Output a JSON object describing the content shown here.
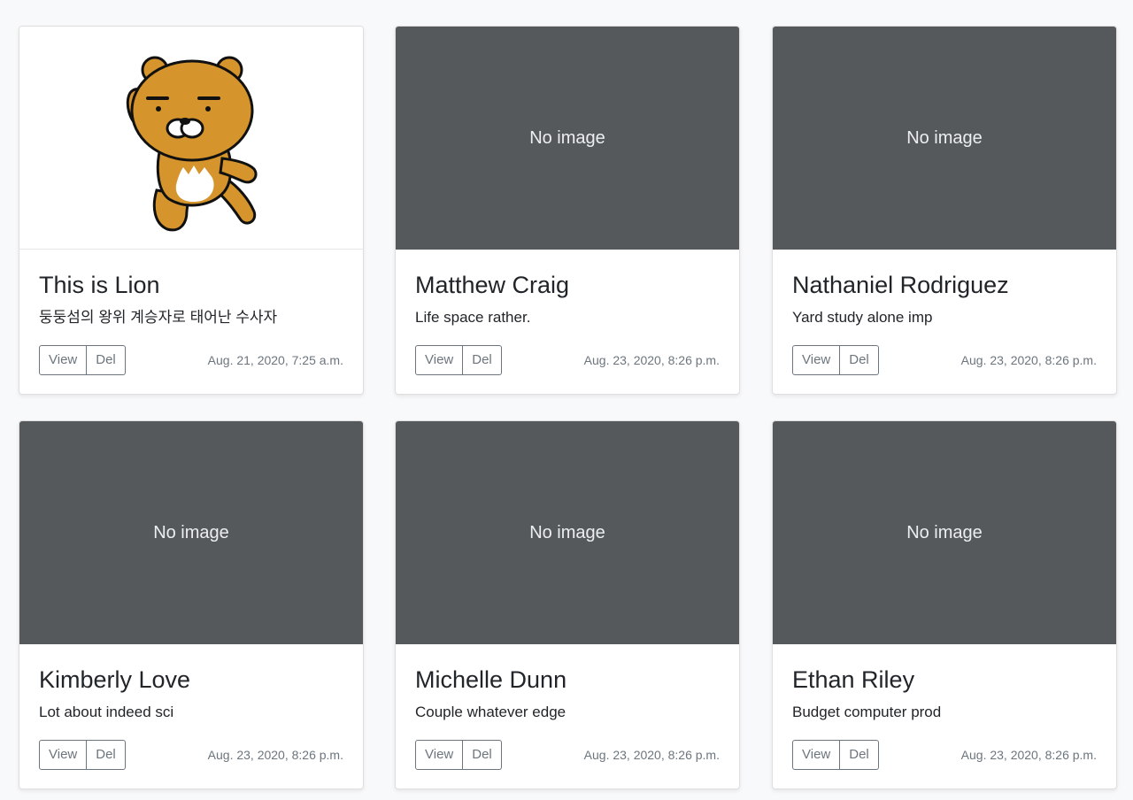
{
  "cards": [
    {
      "image": "lion-character",
      "placeholder": "",
      "title": "This is Lion",
      "text": "둥둥섬의 왕위 계승자로 태어난 수사자",
      "view_label": "View",
      "del_label": "Del",
      "date": "Aug. 21, 2020, 7:25 a.m."
    },
    {
      "image": "none",
      "placeholder": "No image",
      "title": "Matthew Craig",
      "text": "Life space rather.",
      "view_label": "View",
      "del_label": "Del",
      "date": "Aug. 23, 2020, 8:26 p.m."
    },
    {
      "image": "none",
      "placeholder": "No image",
      "title": "Nathaniel Rodriguez",
      "text": "Yard study alone imp",
      "view_label": "View",
      "del_label": "Del",
      "date": "Aug. 23, 2020, 8:26 p.m."
    },
    {
      "image": "none",
      "placeholder": "No image",
      "title": "Kimberly Love",
      "text": "Lot about indeed sci",
      "view_label": "View",
      "del_label": "Del",
      "date": "Aug. 23, 2020, 8:26 p.m."
    },
    {
      "image": "none",
      "placeholder": "No image",
      "title": "Michelle Dunn",
      "text": "Couple whatever edge",
      "view_label": "View",
      "del_label": "Del",
      "date": "Aug. 23, 2020, 8:26 p.m."
    },
    {
      "image": "none",
      "placeholder": "No image",
      "title": "Ethan Riley",
      "text": "Budget computer prod",
      "view_label": "View",
      "del_label": "Del",
      "date": "Aug. 23, 2020, 8:26 p.m."
    }
  ],
  "colors": {
    "placeholder_bg": "#55595c",
    "placeholder_text": "#eceeef",
    "button_border": "#6c757d",
    "page_bg": "#f8f9fa"
  }
}
